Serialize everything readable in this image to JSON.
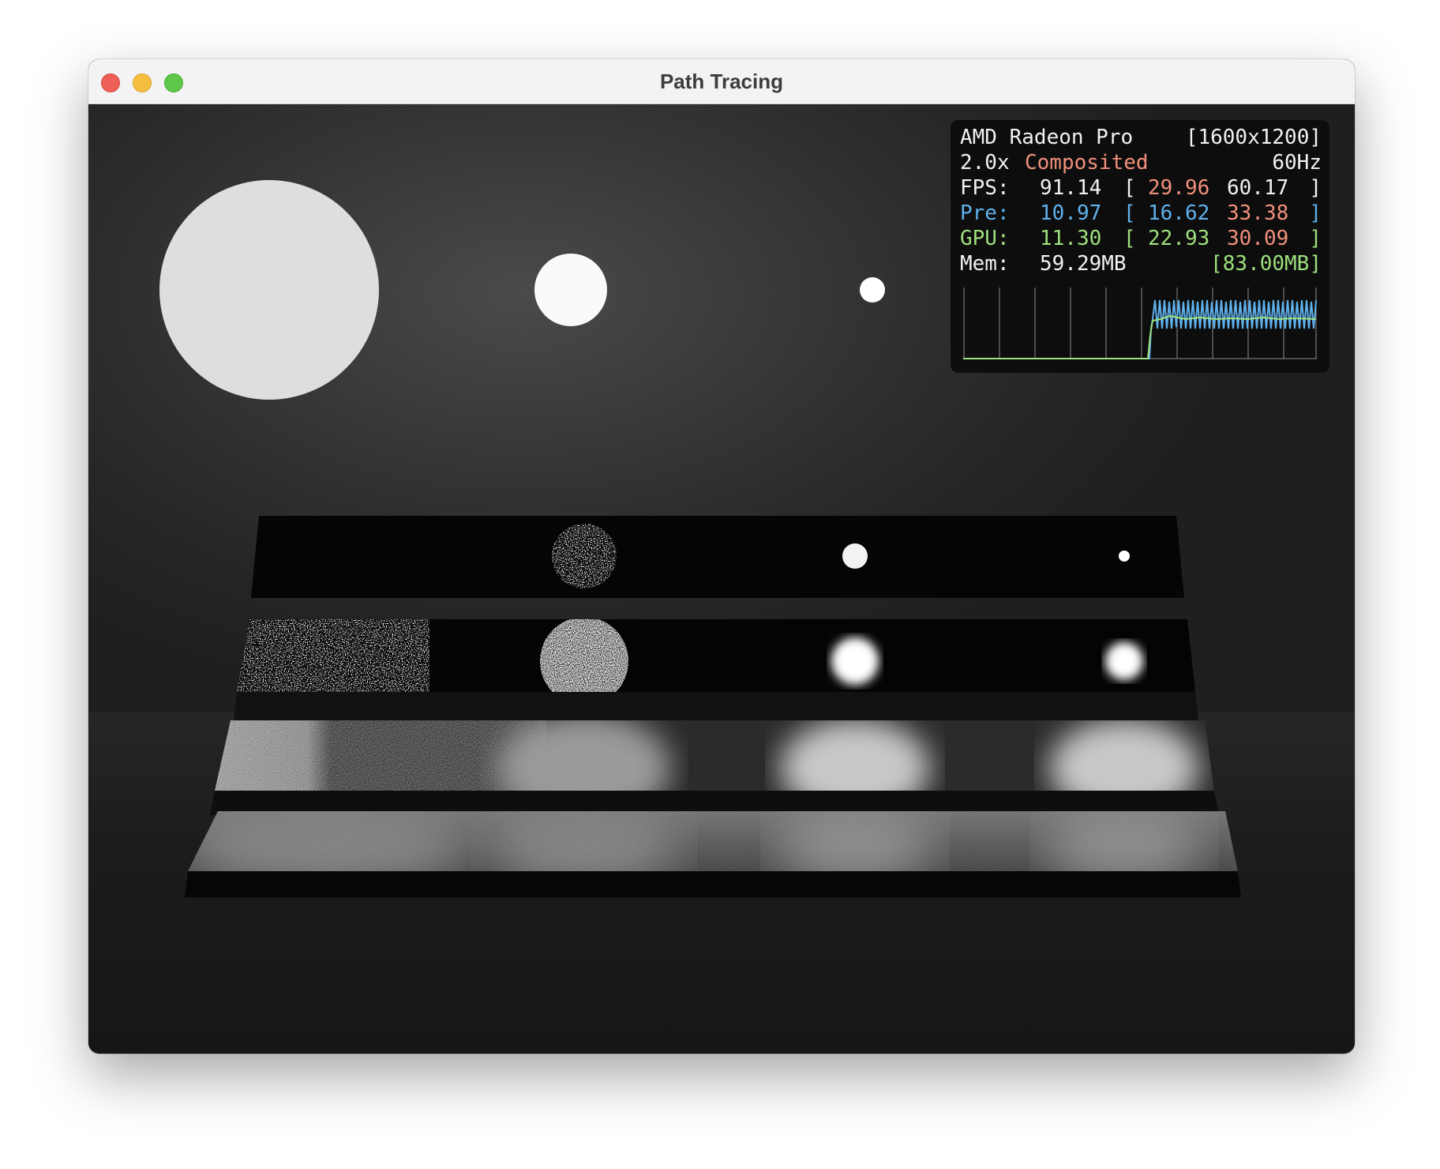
{
  "window": {
    "title": "Path Tracing"
  },
  "stats": {
    "gpu_name": "AMD Radeon Pro",
    "resolution": "[1600x1200]",
    "scale": "2.0x",
    "mode": "Composited",
    "refresh": "60Hz",
    "fps": {
      "label": "FPS:",
      "value": "91.14",
      "bracket_open": "[",
      "min": "29.96",
      "max": "60.17",
      "bracket_close": "]"
    },
    "pre": {
      "label": "Pre:",
      "value": "10.97",
      "bracket_open": "[",
      "min": "16.62",
      "max": "33.38",
      "bracket_close": "]"
    },
    "gpu": {
      "label": "GPU:",
      "value": "11.30",
      "bracket_open": "[",
      "min": "22.93",
      "max": "30.09",
      "bracket_close": "]"
    },
    "mem": {
      "label": "Mem:",
      "value": "59.29MB",
      "max": "[83.00MB]"
    }
  },
  "colors": {
    "stat_white": "#f2f2f2",
    "stat_red": "#f0907c",
    "stat_blue": "#5fb1ec",
    "stat_green": "#9ee07d",
    "overlay_bg": "#0c0c0c"
  }
}
